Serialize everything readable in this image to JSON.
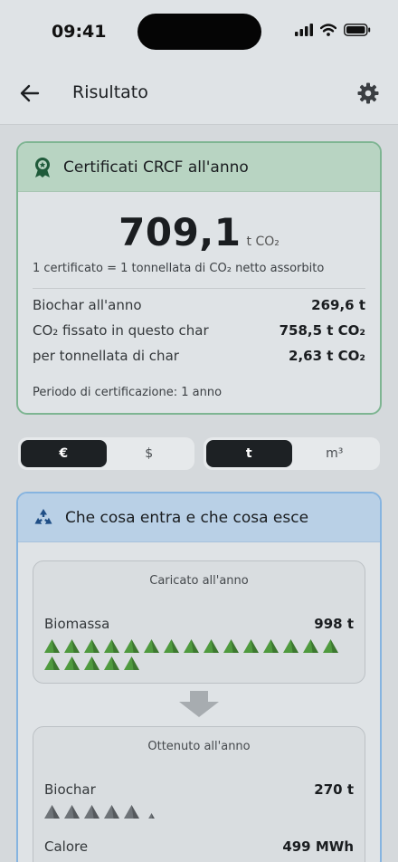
{
  "status": {
    "time": "09:41"
  },
  "header": {
    "title": "Risultato"
  },
  "cert": {
    "title": "Certificati CRCF all'anno",
    "value": "709,1",
    "unit": "t CO₂",
    "note": "1 certificato = 1 tonnellata di CO₂ netto assorbito",
    "rows": [
      {
        "label": "Biochar all'anno",
        "value": "269,6 t"
      },
      {
        "label": "CO₂ fissato in questo char",
        "value": "758,5 t CO₂"
      },
      {
        "label": "per tonnellata di char",
        "value": "2,63 t CO₂"
      }
    ],
    "period": "Periodo di certificazione: 1 anno"
  },
  "currency_toggle": {
    "options": [
      "€",
      "$"
    ],
    "selected": "€"
  },
  "unit_toggle": {
    "options": [
      "t",
      "m³"
    ],
    "selected": "t"
  },
  "flow": {
    "title": "Che cosa entra e che cosa esce",
    "input": {
      "title": "Caricato all'anno",
      "items": [
        {
          "label": "Biomassa",
          "value": "998 t",
          "icons": 20
        }
      ]
    },
    "output": {
      "title": "Ottenuto all'anno",
      "items": [
        {
          "label": "Biochar",
          "value": "270 t",
          "icons": 5.4
        },
        {
          "label": "Calore",
          "value": "499 MWh"
        }
      ]
    }
  },
  "colors": {
    "biomass": "#4f9a3e",
    "biochar": "#6e7378",
    "cert_border": "#7eb592",
    "flow_border": "#86b4e0"
  }
}
